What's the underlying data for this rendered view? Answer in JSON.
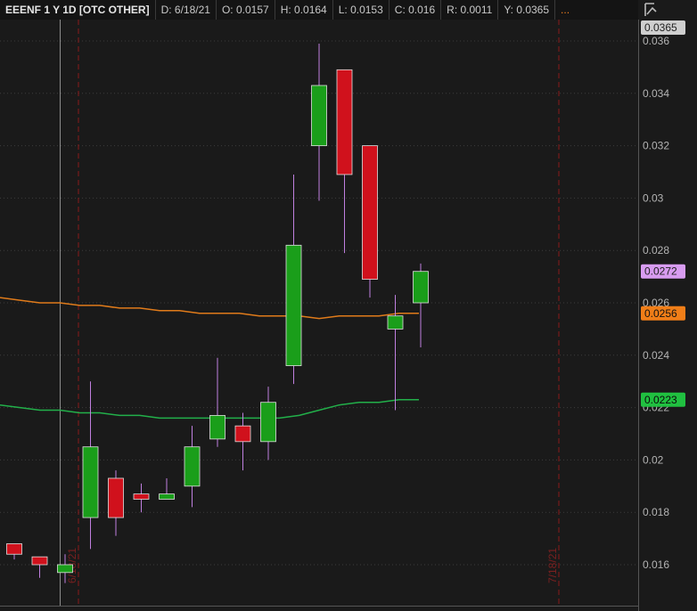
{
  "header": {
    "symbol": "EEENF 1 Y 1D [OTC OTHER]",
    "date": "D: 6/18/21",
    "open": "O: 0.0157",
    "high": "H: 0.0164",
    "low": "L: 0.0153",
    "close": "C: 0.016",
    "range": "R: 0.0011",
    "y": "Y: 0.0365",
    "more": "..."
  },
  "colors": {
    "background": "#1a1a1a",
    "up": "#1a9e1a",
    "down": "#d0111c",
    "wick": "#c080e0",
    "ma_orange": "#e07b1a",
    "ma_green": "#22b04a",
    "date_marker": "#8a1a1a"
  },
  "chart_data": {
    "type": "candlestick",
    "y_axis": {
      "min": 0.015,
      "max": 0.0365,
      "ticks": [
        "0.036",
        "0.034",
        "0.032",
        "0.03",
        "0.028",
        "0.026",
        "0.024",
        "0.022",
        "0.02",
        "0.018",
        "0.016"
      ]
    },
    "candles": [
      {
        "open": 0.0168,
        "high": 0.0168,
        "low": 0.0162,
        "close": 0.0164
      },
      {
        "open": 0.0163,
        "high": 0.0163,
        "low": 0.0155,
        "close": 0.016
      },
      {
        "open": 0.0157,
        "high": 0.0164,
        "low": 0.0153,
        "close": 0.016
      },
      {
        "open": 0.0178,
        "high": 0.023,
        "low": 0.0166,
        "close": 0.0205
      },
      {
        "open": 0.0193,
        "high": 0.0196,
        "low": 0.0171,
        "close": 0.0178
      },
      {
        "open": 0.0187,
        "high": 0.0191,
        "low": 0.018,
        "close": 0.0185
      },
      {
        "open": 0.0185,
        "high": 0.0193,
        "low": 0.0185,
        "close": 0.0187
      },
      {
        "open": 0.019,
        "high": 0.0213,
        "low": 0.0182,
        "close": 0.0205
      },
      {
        "open": 0.0208,
        "high": 0.0239,
        "low": 0.0205,
        "close": 0.0217
      },
      {
        "open": 0.0213,
        "high": 0.0218,
        "low": 0.0196,
        "close": 0.0207
      },
      {
        "open": 0.0207,
        "high": 0.0228,
        "low": 0.02,
        "close": 0.0222
      },
      {
        "open": 0.0236,
        "high": 0.0309,
        "low": 0.0229,
        "close": 0.0282
      },
      {
        "open": 0.032,
        "high": 0.0359,
        "low": 0.0299,
        "close": 0.0343
      },
      {
        "open": 0.0349,
        "high": 0.0349,
        "low": 0.0279,
        "close": 0.0309
      },
      {
        "open": 0.032,
        "high": 0.032,
        "low": 0.0262,
        "close": 0.0269
      },
      {
        "open": 0.025,
        "high": 0.0263,
        "low": 0.0219,
        "close": 0.0255
      },
      {
        "open": 0.026,
        "high": 0.0275,
        "low": 0.0243,
        "close": 0.0272
      }
    ],
    "ma_orange": [
      0.0262,
      0.0261,
      0.026,
      0.026,
      0.0259,
      0.0259,
      0.0258,
      0.0258,
      0.0257,
      0.0257,
      0.0256,
      0.0256,
      0.0256,
      0.0255,
      0.0255,
      0.0255,
      0.0254,
      0.0255,
      0.0255,
      0.0255,
      0.0256,
      0.0256
    ],
    "ma_green": [
      0.0221,
      0.022,
      0.0219,
      0.0219,
      0.0218,
      0.0218,
      0.0217,
      0.0217,
      0.0216,
      0.0216,
      0.0216,
      0.0216,
      0.0216,
      0.0216,
      0.0216,
      0.0217,
      0.0219,
      0.0221,
      0.0222,
      0.0222,
      0.0223,
      0.0223
    ],
    "date_markers": [
      "6/18/21",
      "7/18/21"
    ],
    "price_badges": [
      {
        "label": "0.0365",
        "value": 0.0365,
        "bg": "#cfcfcf",
        "fg": "#222222"
      },
      {
        "label": "0.0272",
        "value": 0.0272,
        "bg": "#d89cf0",
        "fg": "#222222"
      },
      {
        "label": "0.0256",
        "value": 0.0256,
        "bg": "#f07e18",
        "fg": "#111111"
      },
      {
        "label": "0.0223",
        "value": 0.0223,
        "bg": "#20c040",
        "fg": "#0a0a0a"
      }
    ]
  }
}
